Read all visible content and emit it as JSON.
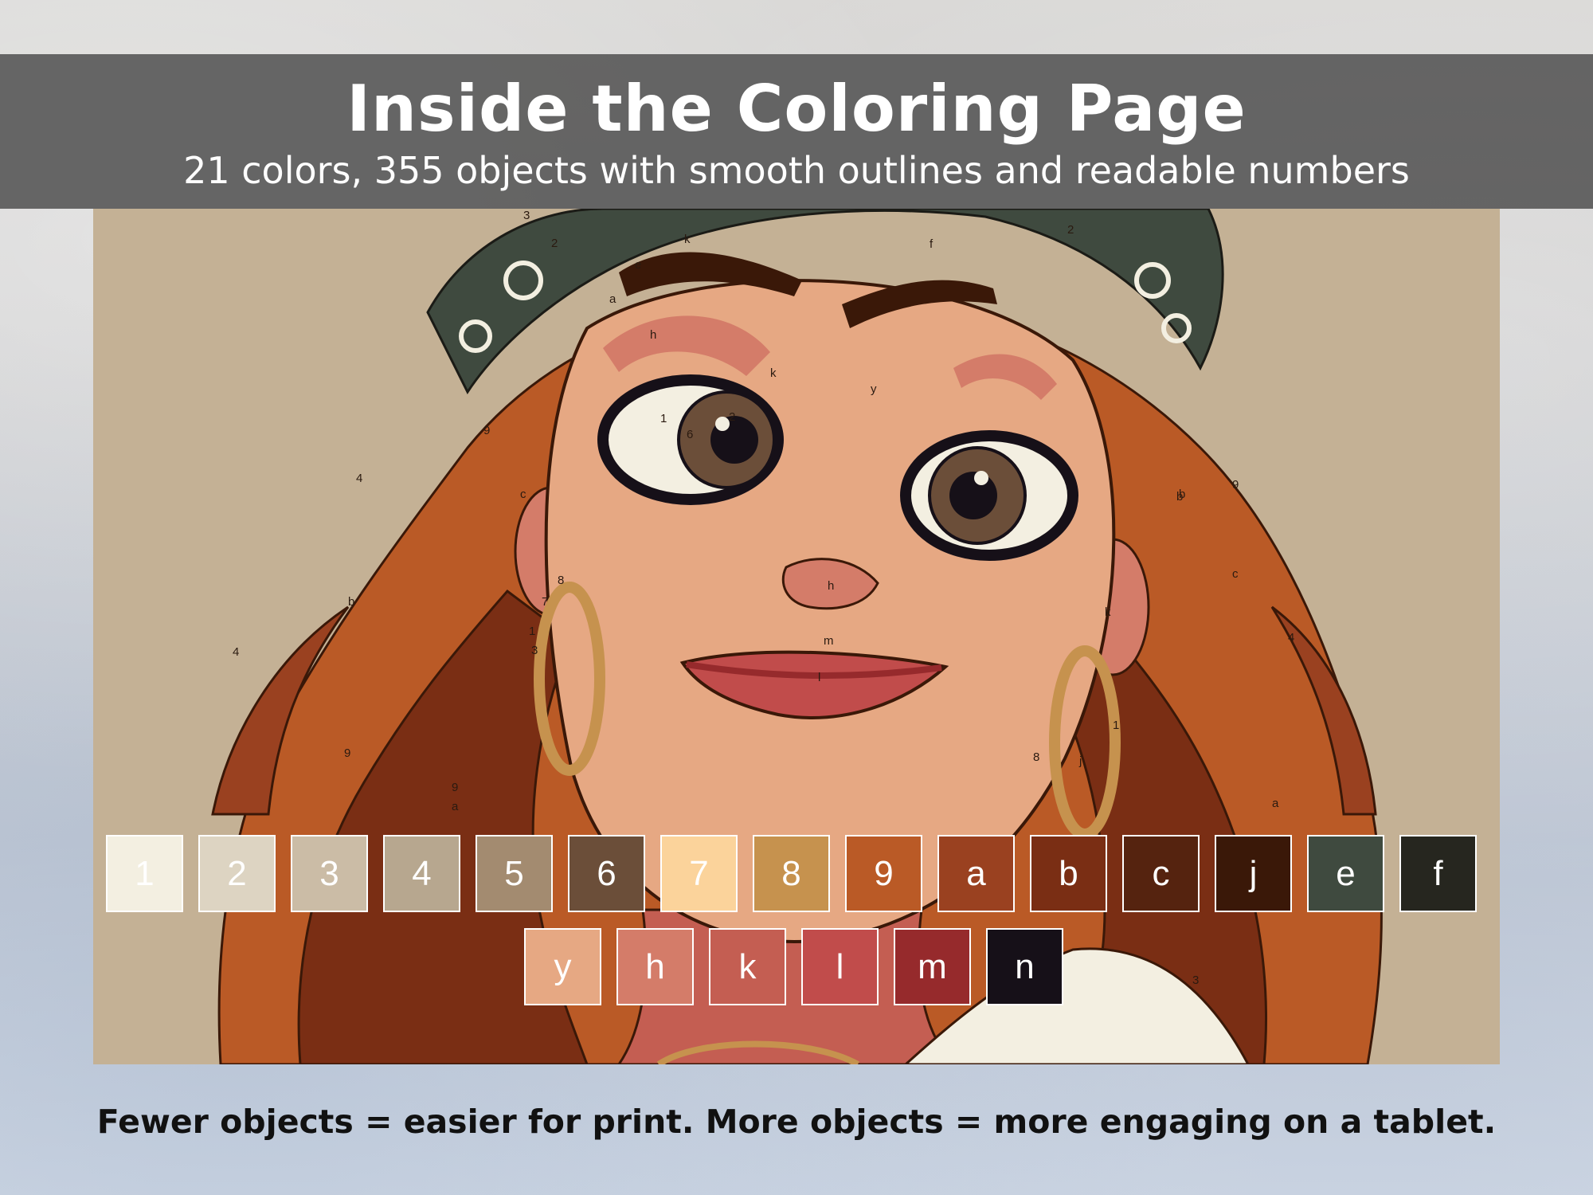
{
  "header": {
    "title": "Inside the Coloring Page",
    "subtitle": "21 colors, 355 objects with smooth outlines and readable numbers"
  },
  "palette": {
    "row1": [
      {
        "label": "1",
        "color": "#f3efe1",
        "text": "#ffffff"
      },
      {
        "label": "2",
        "color": "#ddd4c2",
        "text": "#ffffff"
      },
      {
        "label": "3",
        "color": "#cbbca6",
        "text": "#ffffff"
      },
      {
        "label": "4",
        "color": "#b7a78f",
        "text": "#ffffff"
      },
      {
        "label": "5",
        "color": "#a38b70",
        "text": "#ffffff"
      },
      {
        "label": "6",
        "color": "#6b4e39",
        "text": "#ffffff"
      },
      {
        "label": "7",
        "color": "#fbd39b",
        "text": "#ffffff"
      },
      {
        "label": "8",
        "color": "#c6924e",
        "text": "#ffffff"
      },
      {
        "label": "9",
        "color": "#ba5a26",
        "text": "#ffffff"
      },
      {
        "label": "a",
        "color": "#9a4120",
        "text": "#ffffff"
      },
      {
        "label": "b",
        "color": "#7a2e14",
        "text": "#ffffff"
      },
      {
        "label": "c",
        "color": "#55230f",
        "text": "#ffffff"
      },
      {
        "label": "j",
        "color": "#3a1808",
        "text": "#ffffff"
      },
      {
        "label": "e",
        "color": "#3f4a3f",
        "text": "#ffffff"
      },
      {
        "label": "f",
        "color": "#26261f",
        "text": "#ffffff"
      }
    ],
    "row2": [
      {
        "label": "y",
        "color": "#e6a883",
        "text": "#ffffff"
      },
      {
        "label": "h",
        "color": "#d47c69",
        "text": "#ffffff"
      },
      {
        "label": "k",
        "color": "#c45e52",
        "text": "#ffffff"
      },
      {
        "label": "l",
        "color": "#c14c4b",
        "text": "#ffffff"
      },
      {
        "label": "m",
        "color": "#962a2c",
        "text": "#ffffff"
      },
      {
        "label": "n",
        "color": "#161018",
        "text": "#ffffff"
      }
    ]
  },
  "artwork": {
    "labels": [
      "3",
      "2",
      "k",
      "e",
      "a",
      "9",
      "c",
      "y",
      "h",
      "1",
      "2",
      "6",
      "k",
      "4",
      "b",
      "9",
      "8",
      "7",
      "1",
      "3",
      "l",
      "m",
      "h",
      "k",
      "8",
      "1",
      "j",
      "a",
      "4",
      "9",
      "b",
      "c",
      "3",
      "9",
      "a",
      "4",
      "f",
      "2",
      "b"
    ]
  },
  "footer": {
    "text": "Fewer objects = easier for print. More objects = more engaging on a tablet."
  }
}
